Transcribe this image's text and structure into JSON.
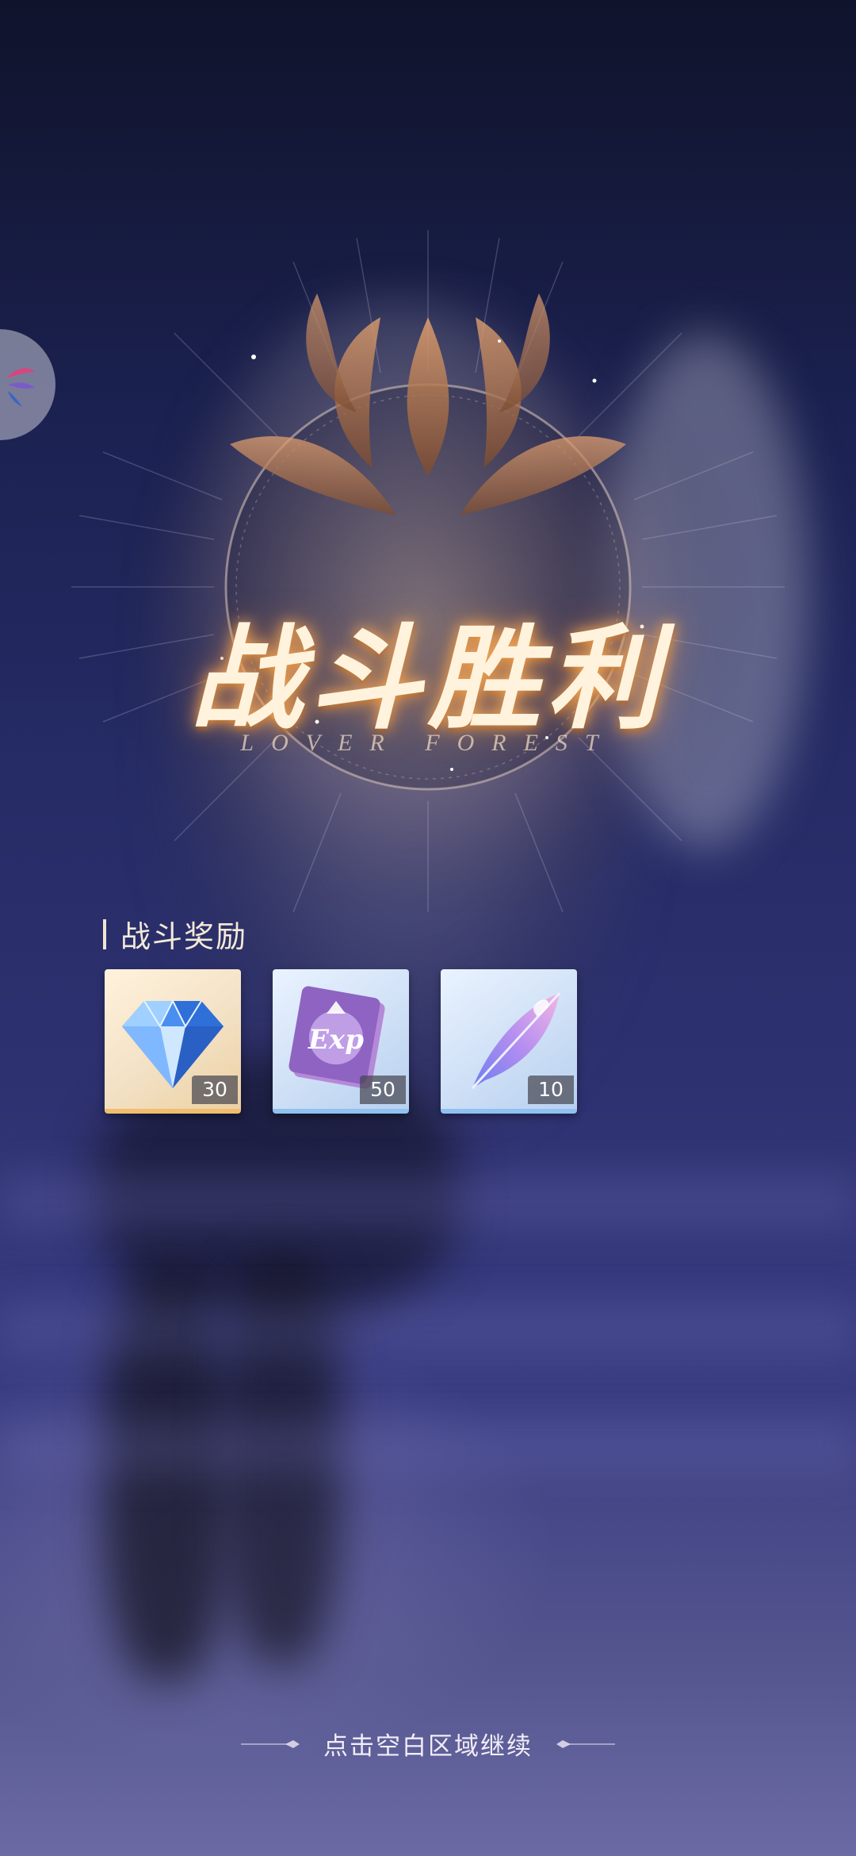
{
  "result": {
    "title": "战斗胜利",
    "subtitle": "LOVER FOREST"
  },
  "rewards": {
    "header": "战斗奖励",
    "items": [
      {
        "name": "diamond",
        "quantity": "30",
        "frame": "gold",
        "icon": "diamond-icon"
      },
      {
        "name": "exp-book",
        "quantity": "50",
        "frame": "blue",
        "icon": "exp-book-icon"
      },
      {
        "name": "feather",
        "quantity": "10",
        "frame": "blue",
        "icon": "feather-icon"
      }
    ]
  },
  "footer": {
    "continue_hint": "点击空白区域继续"
  },
  "colors": {
    "accent_gold": "#f0be6e",
    "frame_blue": "#8fc2f0",
    "title_glow": "#ffaf5a"
  }
}
